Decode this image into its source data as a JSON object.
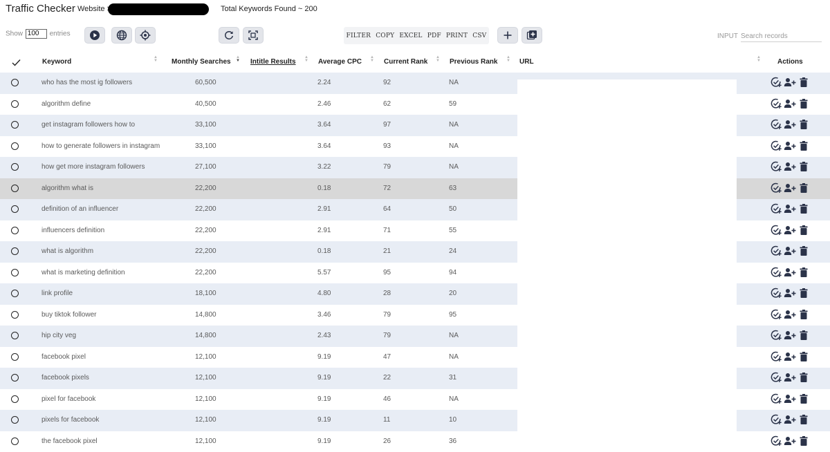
{
  "app": {
    "title": "Traffic Checker",
    "website_label": "Website >",
    "total_keywords": "Total Keywords Found ~ 200"
  },
  "controls": {
    "show_label": "Show",
    "entries_value": "100",
    "entries_label": "entries",
    "export_buttons": [
      "FILTER",
      "COPY",
      "EXCEL",
      "PDF",
      "PRINT",
      "CSV"
    ],
    "search_label": "INPUT",
    "search_placeholder": "Search records"
  },
  "table": {
    "headers": {
      "keyword": "Keyword",
      "monthly_searches": "Monthly Searches",
      "intitle_results": "Intitle Results",
      "average_cpc": "Average CPC",
      "current_rank": "Current Rank",
      "previous_rank": "Previous Rank",
      "url": "URL",
      "actions": "Actions"
    },
    "rows": [
      {
        "keyword": "who has the most ig followers",
        "searches": "60,500",
        "cpc": "2.24",
        "current": "92",
        "previous": "NA"
      },
      {
        "keyword": "algorithm define",
        "searches": "40,500",
        "cpc": "2.46",
        "current": "62",
        "previous": "59"
      },
      {
        "keyword": "get instagram followers how to",
        "searches": "33,100",
        "cpc": "3.64",
        "current": "97",
        "previous": "NA"
      },
      {
        "keyword": "how to generate followers in instagram",
        "searches": "33,100",
        "cpc": "3.64",
        "current": "93",
        "previous": "NA"
      },
      {
        "keyword": "how get more instagram followers",
        "searches": "27,100",
        "cpc": "3.22",
        "current": "79",
        "previous": "NA"
      },
      {
        "keyword": "algorithm what is",
        "searches": "22,200",
        "cpc": "0.18",
        "current": "72",
        "previous": "63"
      },
      {
        "keyword": "definition of an influencer",
        "searches": "22,200",
        "cpc": "2.91",
        "current": "64",
        "previous": "50"
      },
      {
        "keyword": "influencers definition",
        "searches": "22,200",
        "cpc": "2.91",
        "current": "71",
        "previous": "55"
      },
      {
        "keyword": "what is algorithm",
        "searches": "22,200",
        "cpc": "0.18",
        "current": "21",
        "previous": "24"
      },
      {
        "keyword": "what is marketing definition",
        "searches": "22,200",
        "cpc": "5.57",
        "current": "95",
        "previous": "94"
      },
      {
        "keyword": "link profile",
        "searches": "18,100",
        "cpc": "4.80",
        "current": "28",
        "previous": "20"
      },
      {
        "keyword": "buy tiktok follower",
        "searches": "14,800",
        "cpc": "3.46",
        "current": "79",
        "previous": "95"
      },
      {
        "keyword": "hip city veg",
        "searches": "14,800",
        "cpc": "2.43",
        "current": "79",
        "previous": "NA"
      },
      {
        "keyword": "facebook pixel",
        "searches": "12,100",
        "cpc": "9.19",
        "current": "47",
        "previous": "NA"
      },
      {
        "keyword": "facebook pixels",
        "searches": "12,100",
        "cpc": "9.19",
        "current": "22",
        "previous": "31"
      },
      {
        "keyword": "pixel for facebook",
        "searches": "12,100",
        "cpc": "9.19",
        "current": "46",
        "previous": "NA"
      },
      {
        "keyword": "pixels for facebook",
        "searches": "12,100",
        "cpc": "9.19",
        "current": "11",
        "previous": "10"
      },
      {
        "keyword": "the facebook pixel",
        "searches": "12,100",
        "cpc": "9.19",
        "current": "26",
        "previous": "36"
      }
    ],
    "highlighted_row": 5
  },
  "icons": {
    "toolbar": [
      "play-icon",
      "globe-icon",
      "target-icon",
      "refresh-icon",
      "fullscreen-icon",
      "add-icon",
      "add-box-icon"
    ],
    "row_actions": [
      "check-plus-icon",
      "add-person-icon",
      "trash-icon"
    ]
  },
  "colors": {
    "odd_row": "#e8edf5",
    "highlight_row": "#d8d8d8",
    "button_bg": "#e3e5ea",
    "icon_dark": "#2b3349"
  }
}
